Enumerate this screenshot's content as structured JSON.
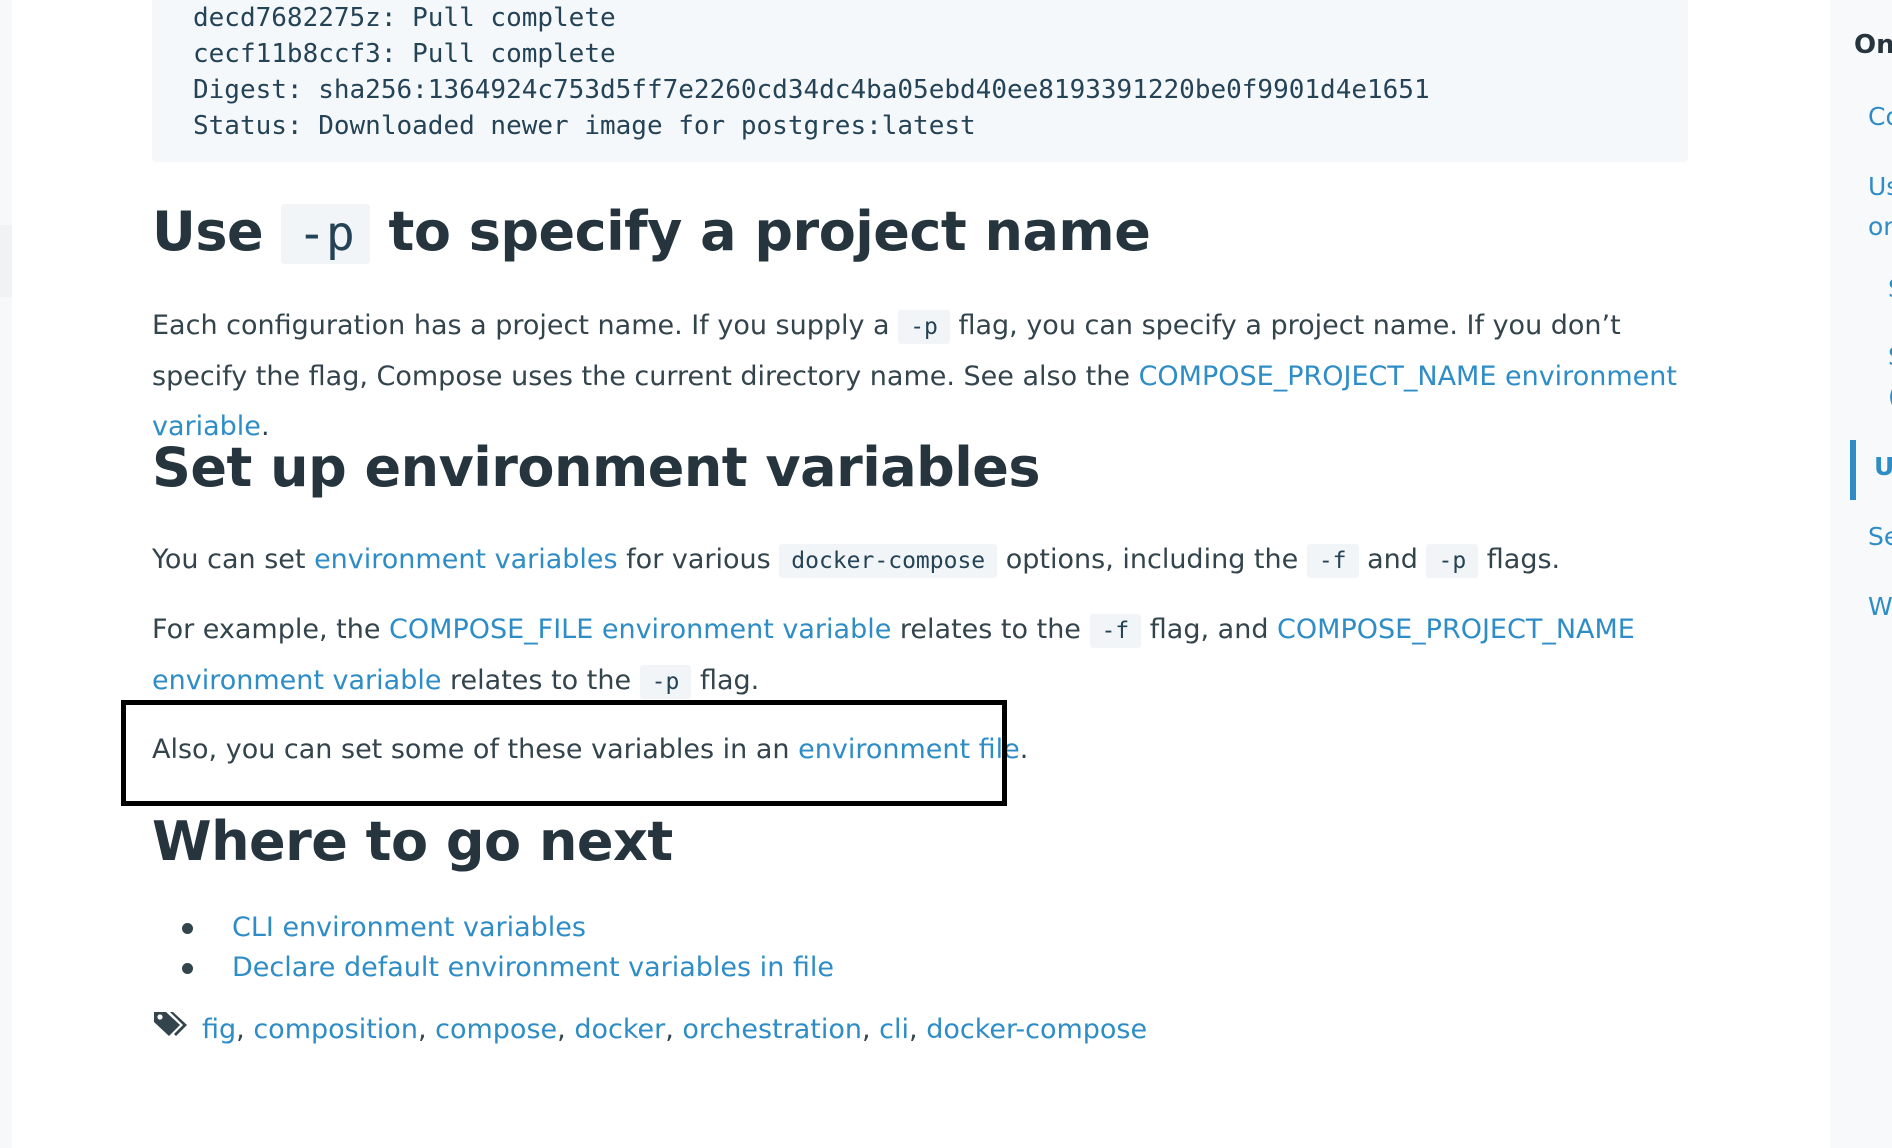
{
  "code": {
    "lines": [
      "decd7682275z: Pull complete",
      "cecf11b8ccf3: Pull complete",
      "Digest: sha256:1364924c753d5ff7e2260cd34dc4ba05ebd40ee8193391220be0f9901d4e1651",
      "Status: Downloaded newer image for postgres:latest"
    ]
  },
  "section_p": {
    "heading_pre": "Use ",
    "heading_code": "-p",
    "heading_post": " to specify a project name",
    "para_1": "Each configuration has a project name. If you supply a ",
    "code_1": "-p",
    "para_2": " flag, you can specify a project name. If you don’t specify the flag, Compose uses the current directory name. See also the ",
    "link": "COMPOSE_PROJECT_NAME environment variable",
    "para_end": "."
  },
  "section_env": {
    "heading": "Set up environment variables",
    "p1": {
      "t1": "You can set ",
      "link": "environment variables",
      "t2": " for various ",
      "code1": "docker-compose",
      "t3": " options, including the ",
      "code2": "-f",
      "t4": " and ",
      "code3": "-p",
      "t5": " flags."
    },
    "p2": {
      "t1": "For example, the ",
      "link1": "COMPOSE_FILE environment variable",
      "t2": " relates to the ",
      "code1": "-f",
      "t3": " flag, and ",
      "link2": "COMPOSE_PROJECT_NAME environment variable",
      "t4": " relates to the ",
      "code2": "-p",
      "t5": " flag."
    },
    "p3": {
      "t1": "Also, you can set some of these variables in an ",
      "link": "environment file",
      "t2": "."
    }
  },
  "section_next": {
    "heading": "Where to go next",
    "items": [
      "CLI environment variables",
      "Declare default environment variables in file"
    ]
  },
  "tags": [
    "fig",
    "composition",
    "compose",
    "docker",
    "orchestration",
    "cli",
    "docker-compose"
  ],
  "toc": {
    "title": "On",
    "items": [
      "Co",
      "Us",
      "or",
      "S",
      "S",
      "(",
      "U",
      "Se",
      "W"
    ]
  }
}
